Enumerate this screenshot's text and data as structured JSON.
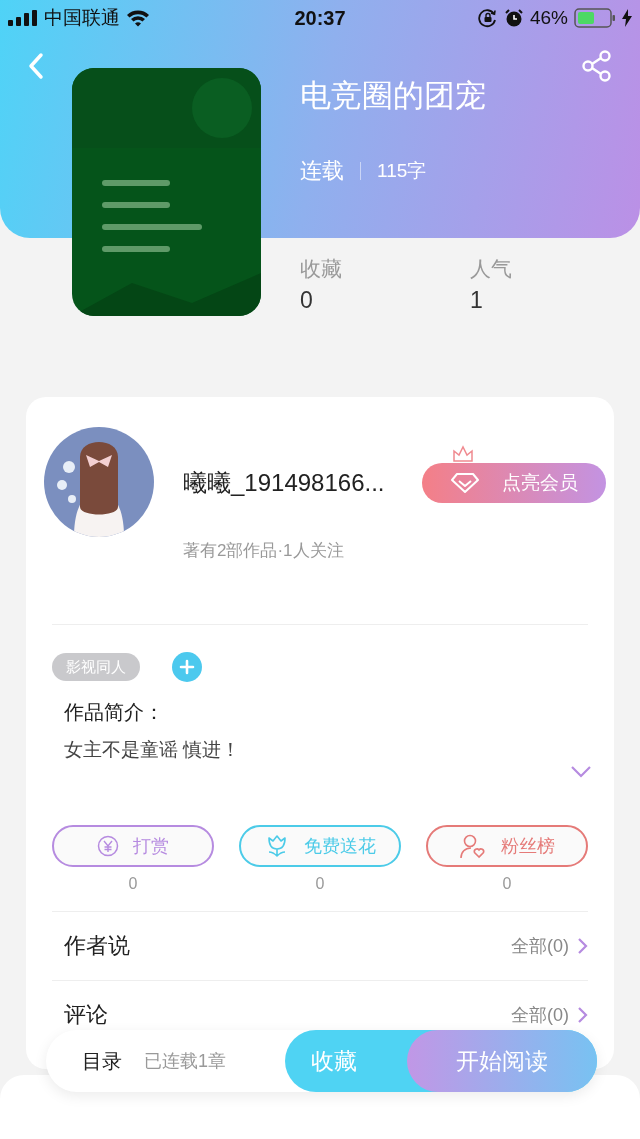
{
  "status_bar": {
    "carrier": "中国联通",
    "time": "20:37",
    "battery": "46%"
  },
  "book": {
    "title": "电竞圈的团宠",
    "status": "连载",
    "word_count": "115字",
    "stats": [
      {
        "label": "收藏",
        "value": "0"
      },
      {
        "label": "人气",
        "value": "1"
      }
    ]
  },
  "author": {
    "name": "曦曦_191498166...",
    "subtitle": "著有2部作品·1人关注",
    "vip_button": "点亮会员"
  },
  "tags": [
    "影视同人"
  ],
  "synopsis": {
    "label": "作品简介：",
    "text": "女主不是童谣 慎进！"
  },
  "actions": [
    {
      "kind": "reward",
      "label": "打赏",
      "count": "0",
      "color": "#b68be0"
    },
    {
      "kind": "flower",
      "label": "免费送花",
      "count": "0",
      "color": "#4ccbe8"
    },
    {
      "kind": "fans",
      "label": "粉丝榜",
      "count": "0",
      "color": "#e57a78"
    }
  ],
  "sections": [
    {
      "label": "作者说",
      "link": "全部(0)"
    },
    {
      "label": "评论",
      "link": "全部(0)"
    }
  ],
  "bottom_bar": {
    "toc": "目录",
    "progress": "已连载1章",
    "buttons": [
      {
        "kind": "collect",
        "label": "收藏"
      },
      {
        "kind": "read",
        "label": "开始阅读"
      }
    ]
  }
}
